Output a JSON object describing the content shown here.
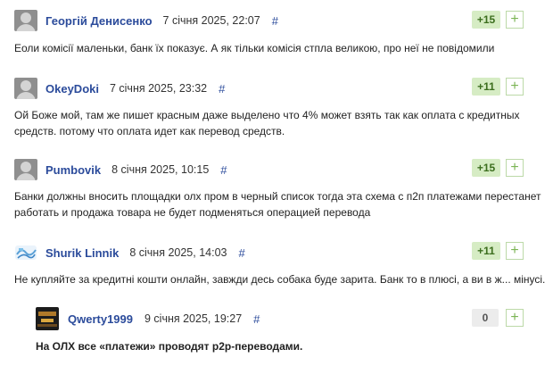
{
  "comments": [
    {
      "author": "Георгій Денисенко",
      "date": "7 січня 2025, 22:07",
      "hash": "#",
      "votes": "+15",
      "plus": "+",
      "text": "Еоли комісії маленьки, банк їх показує. А як тільки комісія стпла великою, про неї не повідомили"
    },
    {
      "author": "OkeyDoki",
      "date": "7 січня 2025, 23:32",
      "hash": "#",
      "votes": "+11",
      "plus": "+",
      "text_line1": "Ой Боже мой, там же пишет красным даже выделено что 4% может взять так как оплата с кредитных",
      "text_line2": "средств. потому что оплата идет как перевод средств."
    },
    {
      "author": "Pumbovik",
      "date": "8 січня 2025, 10:15",
      "hash": "#",
      "votes": "+15",
      "plus": "+",
      "text_line1": "Банки должны вносить площадки олх пром в черный список тогда эта схема с п2п платежами перестанет",
      "text_line2": "работать и продажа товара не будет подменяться операцией перевода"
    },
    {
      "author": "Shurik Linnik",
      "date": "8 січня 2025, 14:03",
      "hash": "#",
      "votes": "+11",
      "plus": "+",
      "text": "Не купляйте за кредитні кошти онлайн, завжди десь собака буде зарита. Банк то в плюсі, а ви в ж... мінусі."
    },
    {
      "author": "Qwerty1999",
      "date": "9 січня 2025, 19:27",
      "hash": "#",
      "votes": "0",
      "plus": "+",
      "text": "На ОЛХ все «платежи» проводят p2p-переводами."
    }
  ],
  "colors": {
    "author": "#2b4b9b",
    "vote_bg": "#d6ecc4",
    "vote_text": "#3c6e1e",
    "plus_border": "#bcd9a8",
    "plus_text": "#7bb454",
    "avatar_gray": "#8f8f8f"
  },
  "icons": {
    "default_avatar": "user-silhouette",
    "shurik_avatar": "text-logo",
    "qwerty_avatar": "game-screenshot"
  }
}
